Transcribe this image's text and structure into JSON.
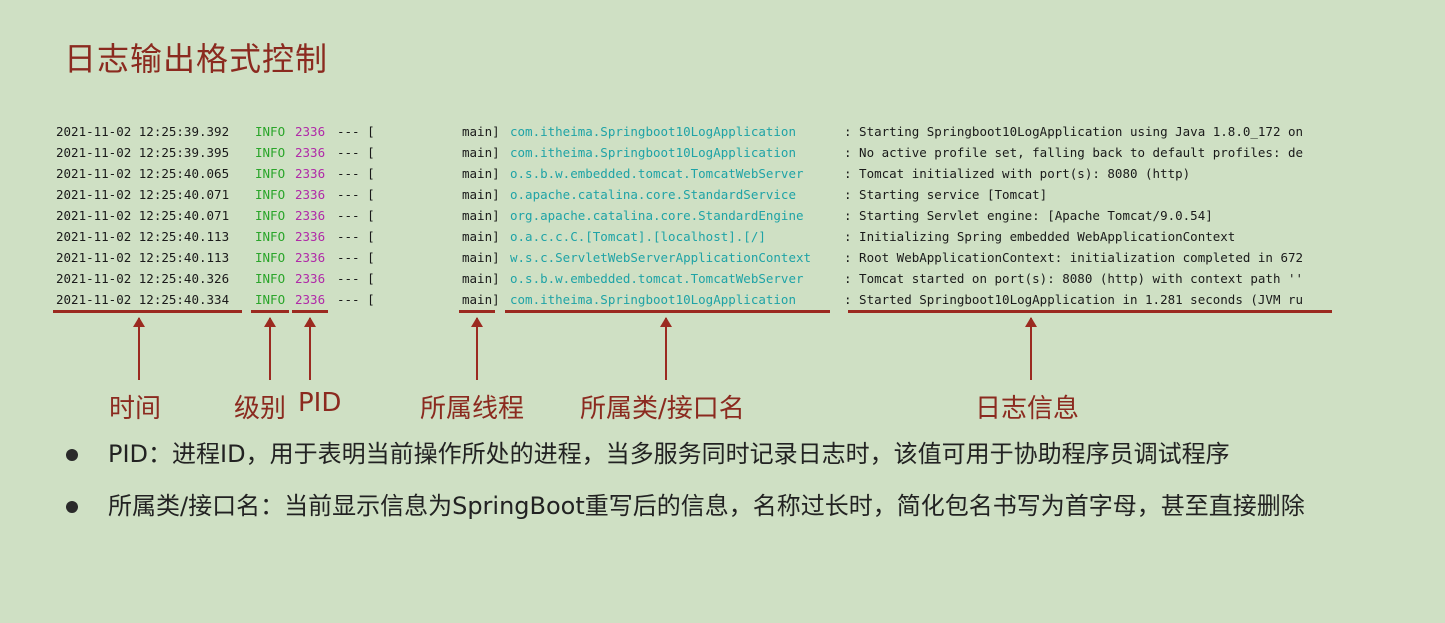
{
  "title": "日志输出格式控制",
  "log_lines": [
    {
      "time": "2021-11-02 12:25:39.392",
      "level": "INFO",
      "pid": "2336",
      "sep": "--- [",
      "thread": "main]",
      "logger": "com.itheima.Springboot10LogApplication",
      "message": ": Starting Springboot10LogApplication using Java 1.8.0_172 on"
    },
    {
      "time": "2021-11-02 12:25:39.395",
      "level": "INFO",
      "pid": "2336",
      "sep": "--- [",
      "thread": "main]",
      "logger": "com.itheima.Springboot10LogApplication",
      "message": ": No active profile set, falling back to default profiles: de"
    },
    {
      "time": "2021-11-02 12:25:40.065",
      "level": "INFO",
      "pid": "2336",
      "sep": "--- [",
      "thread": "main]",
      "logger": "o.s.b.w.embedded.tomcat.TomcatWebServer",
      "message": ": Tomcat initialized with port(s): 8080 (http)"
    },
    {
      "time": "2021-11-02 12:25:40.071",
      "level": "INFO",
      "pid": "2336",
      "sep": "--- [",
      "thread": "main]",
      "logger": "o.apache.catalina.core.StandardService",
      "message": ": Starting service [Tomcat]"
    },
    {
      "time": "2021-11-02 12:25:40.071",
      "level": "INFO",
      "pid": "2336",
      "sep": "--- [",
      "thread": "main]",
      "logger": "org.apache.catalina.core.StandardEngine",
      "message": ": Starting Servlet engine: [Apache Tomcat/9.0.54]"
    },
    {
      "time": "2021-11-02 12:25:40.113",
      "level": "INFO",
      "pid": "2336",
      "sep": "--- [",
      "thread": "main]",
      "logger": "o.a.c.c.C.[Tomcat].[localhost].[/]",
      "message": ": Initializing Spring embedded WebApplicationContext"
    },
    {
      "time": "2021-11-02 12:25:40.113",
      "level": "INFO",
      "pid": "2336",
      "sep": "--- [",
      "thread": "main]",
      "logger": "w.s.c.ServletWebServerApplicationContext",
      "message": ": Root WebApplicationContext: initialization completed in 672"
    },
    {
      "time": "2021-11-02 12:25:40.326",
      "level": "INFO",
      "pid": "2336",
      "sep": "--- [",
      "thread": "main]",
      "logger": "o.s.b.w.embedded.tomcat.TomcatWebServer",
      "message": ": Tomcat started on port(s): 8080 (http) with context path ''"
    },
    {
      "time": "2021-11-02 12:25:40.334",
      "level": "INFO",
      "pid": "2336",
      "sep": "--- [",
      "thread": "main]",
      "logger": "com.itheima.Springboot10LogApplication",
      "message": ": Started Springboot10LogApplication in 1.281 seconds (JVM ru"
    }
  ],
  "labels": {
    "time": "时间",
    "level": "级别",
    "pid": "PID",
    "thread": "所属线程",
    "logger": "所属类/接口名",
    "message": "日志信息"
  },
  "bullets": [
    "PID：进程ID，用于表明当前操作所处的进程，当多服务同时记录日志时，该值可用于协助程序员调试程序",
    "所属类/接口名：当前显示信息为SpringBoot重写后的信息，名称过长时，简化包名书写为首字母，甚至直接删除"
  ],
  "colors": {
    "background": "#cfe0c4",
    "accent": "#9b2a20",
    "level": "#2aa52a",
    "pid": "#b02aa8",
    "logger": "#1fa3a6"
  }
}
